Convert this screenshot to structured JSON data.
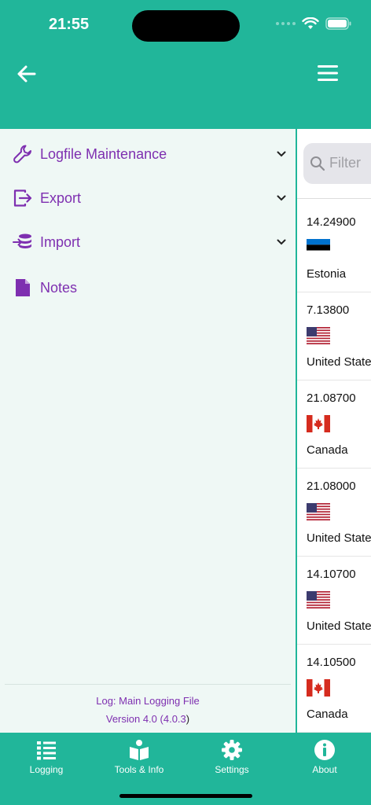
{
  "status": {
    "time": "21:55"
  },
  "drawer": {
    "items": [
      {
        "label": "Logfile Maintenance",
        "icon": "wrench-icon",
        "has_chevron": true
      },
      {
        "label": "Export",
        "icon": "export-icon",
        "has_chevron": true
      },
      {
        "label": "Import",
        "icon": "import-icon",
        "has_chevron": true
      },
      {
        "label": "Notes",
        "icon": "note-icon",
        "has_chevron": false
      }
    ],
    "footer": {
      "log_line": "Log: Main Logging File",
      "version_prefix": "Version 4.0 (",
      "version_build": "4.0.3",
      "version_suffix": ")"
    }
  },
  "list": {
    "filter_placeholder": "Filter",
    "rows": [
      {
        "freq": "14.24900",
        "flag": "estonia-flag",
        "country": "Estonia"
      },
      {
        "freq": "7.13800",
        "flag": "usa-flag",
        "country": "United States"
      },
      {
        "freq": "21.08700",
        "flag": "canada-flag",
        "country": "Canada"
      },
      {
        "freq": "21.08000",
        "flag": "usa-flag",
        "country": "United States"
      },
      {
        "freq": "14.10700",
        "flag": "usa-flag",
        "country": "United States"
      },
      {
        "freq": "14.10500",
        "flag": "canada-flag",
        "country": "Canada"
      }
    ]
  },
  "tabs": [
    {
      "label": "Logging",
      "icon": "list-icon"
    },
    {
      "label": "Tools & Info",
      "icon": "book-icon"
    },
    {
      "label": "Settings",
      "icon": "gear-icon"
    },
    {
      "label": "About",
      "icon": "info-icon"
    }
  ],
  "colors": {
    "accent": "#21B69A",
    "drawer_text": "#7E2FB0",
    "drawer_bg": "#EFF8F5"
  }
}
